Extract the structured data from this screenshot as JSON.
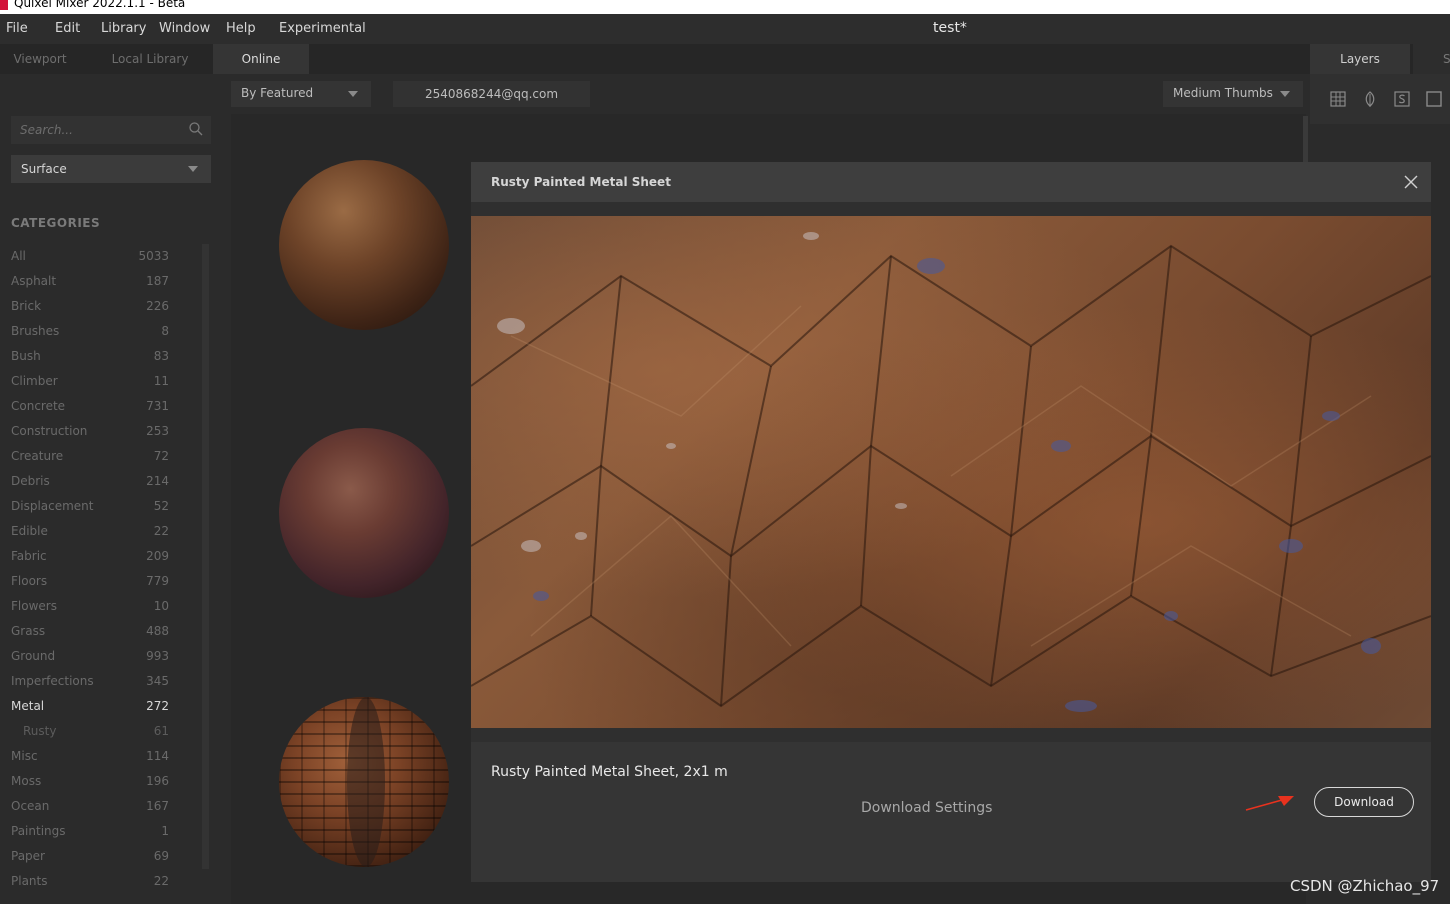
{
  "window": {
    "title": "Quixel Mixer 2022.1.1 - Beta"
  },
  "menu": [
    "File",
    "Edit",
    "Library",
    "Window",
    "Help",
    "Experimental"
  ],
  "document_title": "test*",
  "tabs": [
    {
      "label": "Viewport",
      "active": false
    },
    {
      "label": "Local Library",
      "active": false
    },
    {
      "label": "Online",
      "active": true
    }
  ],
  "right_tabs": {
    "layers": "Layers",
    "next": "S"
  },
  "sidebar": {
    "search_placeholder": "Search...",
    "surface_select": "Surface",
    "categories_heading": "CATEGORIES",
    "categories": [
      {
        "name": "All",
        "count": "5033"
      },
      {
        "name": "Asphalt",
        "count": "187"
      },
      {
        "name": "Brick",
        "count": "226"
      },
      {
        "name": "Brushes",
        "count": "8"
      },
      {
        "name": "Bush",
        "count": "83"
      },
      {
        "name": "Climber",
        "count": "11"
      },
      {
        "name": "Concrete",
        "count": "731"
      },
      {
        "name": "Construction",
        "count": "253"
      },
      {
        "name": "Creature",
        "count": "72"
      },
      {
        "name": "Debris",
        "count": "214"
      },
      {
        "name": "Displacement",
        "count": "52"
      },
      {
        "name": "Edible",
        "count": "22"
      },
      {
        "name": "Fabric",
        "count": "209"
      },
      {
        "name": "Floors",
        "count": "779"
      },
      {
        "name": "Flowers",
        "count": "10"
      },
      {
        "name": "Grass",
        "count": "488"
      },
      {
        "name": "Ground",
        "count": "993"
      },
      {
        "name": "Imperfections",
        "count": "345"
      },
      {
        "name": "Metal",
        "count": "272",
        "active": true
      },
      {
        "name": "Rusty",
        "count": "61",
        "sub": true
      },
      {
        "name": "Misc",
        "count": "114"
      },
      {
        "name": "Moss",
        "count": "196"
      },
      {
        "name": "Ocean",
        "count": "167"
      },
      {
        "name": "Paintings",
        "count": "1"
      },
      {
        "name": "Paper",
        "count": "69"
      },
      {
        "name": "Plants",
        "count": "22"
      }
    ]
  },
  "toolbar": {
    "sort": "By Featured",
    "user": "2540868244@qq.com",
    "thumb_size": "Medium Thumbs"
  },
  "modal": {
    "title": "Rusty Painted Metal Sheet",
    "asset_name": "Rusty Painted Metal Sheet, 2x1 m",
    "download_settings": "Download Settings",
    "download_button": "Download"
  },
  "watermark": "CSDN @Zhichao_97",
  "colors": {
    "annotation_arrow": "#e8321e",
    "brand": "#d3123a"
  }
}
